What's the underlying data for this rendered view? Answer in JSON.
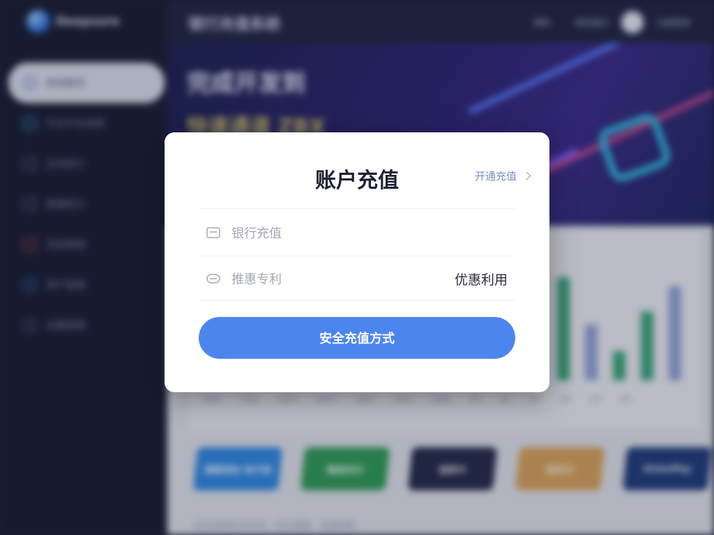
{
  "background": {
    "brand": {
      "name": "Deepsure",
      "icon": "globe-logo-icon"
    },
    "sidebar": {
      "items": [
        {
          "label": "系统首页",
          "icon": "dashboard-icon"
        },
        {
          "label": "平台平台选择",
          "icon": "platform-icon"
        },
        {
          "label": "业务统计",
          "icon": "chart-icon"
        },
        {
          "label": "数据统计",
          "icon": "stats-icon"
        },
        {
          "label": "消息管理",
          "icon": "message-icon"
        },
        {
          "label": "用户管理",
          "icon": "user-icon"
        },
        {
          "label": "设置管理",
          "icon": "settings-icon"
        }
      ]
    },
    "topbar": {
      "title": "银行充值系统",
      "links": [
        "帮助",
        "联系我们",
        "注册登录"
      ]
    },
    "hero": {
      "title": "完成开发到",
      "subtitle": "快速通道 ZBX"
    },
    "chart": {
      "bars": [
        {
          "value": 0.78,
          "color": "#3aa37a"
        },
        {
          "value": 0.42,
          "color": "#8fa0d6"
        },
        {
          "value": 0.22,
          "color": "#3aa37a"
        },
        {
          "value": 0.52,
          "color": "#3aa37a"
        },
        {
          "value": 0.71,
          "color": "#8fa0d6"
        }
      ],
      "xlabels": [
        "W01",
        "Q12",
        "10/3",
        "W03",
        "10/9",
        "10/3",
        "20/8",
        "03",
        "02",
        "03",
        "04",
        "02",
        "04"
      ]
    },
    "payment_cards": [
      {
        "label": "银联钱包 电子钱",
        "color": "#2e86e0"
      },
      {
        "label": "微信支付",
        "color": "#2f9a57"
      },
      {
        "label": "信用卡",
        "color": "#24294a"
      },
      {
        "label": "会员卡",
        "color": "#d7a15a"
      },
      {
        "label": "UnionPay",
        "color": "#1f3c7a"
      }
    ],
    "footnote": "支持多种支付方式 · 安全便捷 · 快速到账"
  },
  "modal": {
    "title": "账户充值",
    "top_link": "开通充值",
    "rows": [
      {
        "label": "银行充值",
        "value": "",
        "icon": "bank-card-icon"
      },
      {
        "label": "推惠专利",
        "value": "优惠利用",
        "icon": "coupon-icon"
      }
    ],
    "primary_button": "安全充值方式",
    "accent": "#4d85ee"
  }
}
